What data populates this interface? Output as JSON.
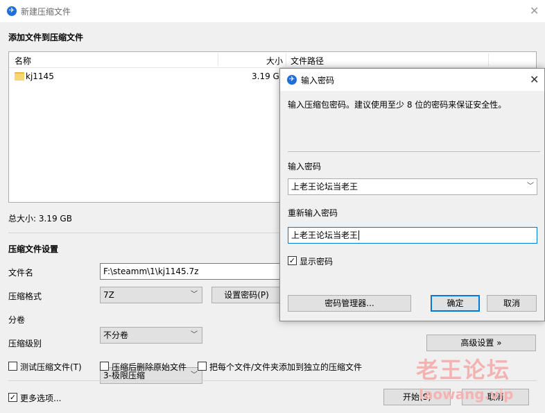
{
  "window": {
    "title": "新建压缩文件",
    "icon": "app-logo-icon",
    "close": "✕"
  },
  "files": {
    "section_title": "添加文件到压缩文件",
    "columns": {
      "name": "名称",
      "size": "大小",
      "path": "文件路径"
    },
    "rows": [
      {
        "name": "kj1145",
        "size": "3.19 GB",
        "icon": "folder-icon"
      }
    ],
    "total": "总大小: 3.19 GB"
  },
  "settings": {
    "section_title": "压缩文件设置",
    "filename_label": "文件名",
    "filename_value": "F:\\steamm\\1\\kj1145.7z",
    "format_label": "压缩格式",
    "format_value": "7Z",
    "split_label": "分卷",
    "split_value": "不分卷",
    "level_label": "压缩级别",
    "level_value": "3-极限压缩",
    "set_password_btn": "设置密码(P)",
    "advanced_btn": "高级设置 »",
    "opt_test": "测试压缩文件(T)",
    "opt_delete": "压缩后删除原始文件",
    "opt_each": "把每个文件/文件夹添加到独立的压缩文件"
  },
  "footer": {
    "more_options": "更多选项...",
    "start": "开始(S)",
    "cancel": "取消"
  },
  "dialog": {
    "title": "输入密码",
    "hint": "输入压缩包密码。建议使用至少 8 位的密码来保证安全性。",
    "password_label": "输入密码",
    "password_value": "上老王论坛当老王",
    "confirm_label": "重新输入密码",
    "confirm_value": "上老王论坛当老王",
    "show_password": "显示密码",
    "manager_btn": "密码管理器...",
    "ok_btn": "确定",
    "cancel_btn": "取消"
  },
  "watermark": {
    "line1": "老王论坛",
    "line2": "laowang.vip"
  },
  "colors": {
    "accent": "#0078d7",
    "watermark": "#f4b3b3"
  }
}
